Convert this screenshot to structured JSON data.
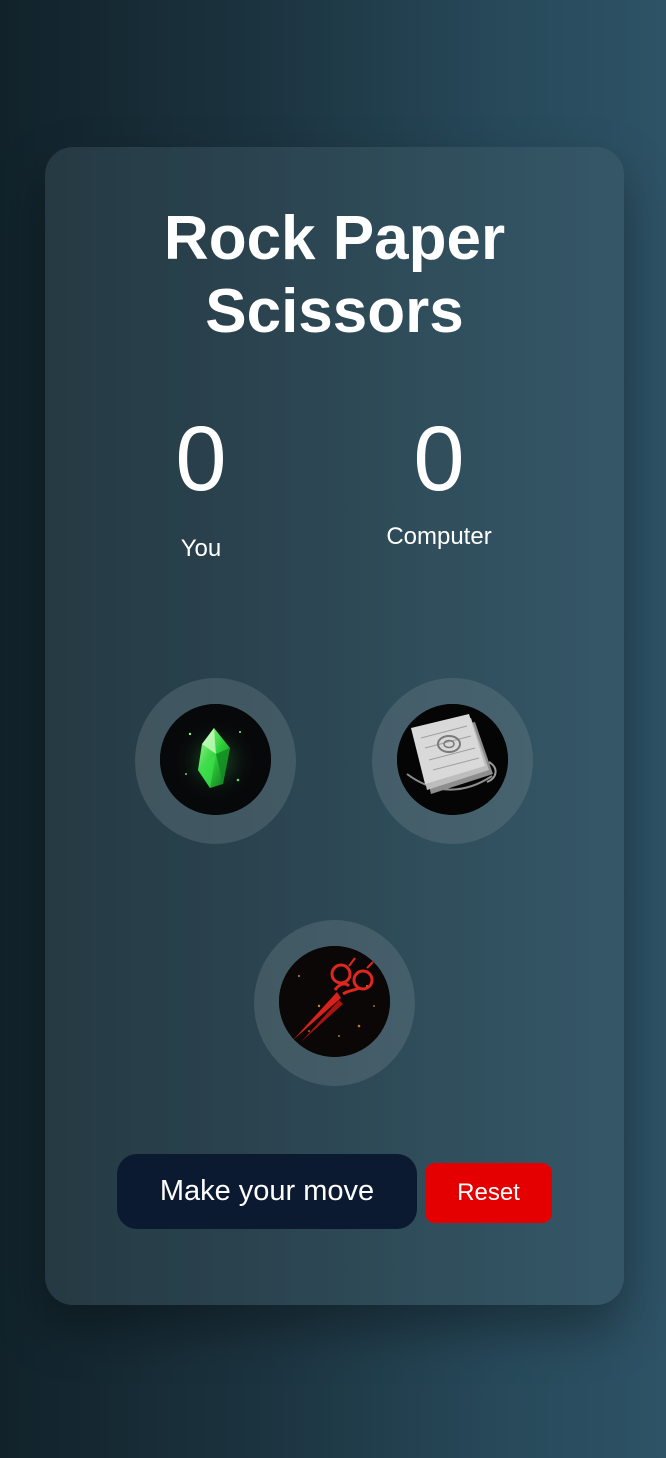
{
  "game": {
    "title": "Rock Paper Scissors"
  },
  "scores": {
    "player_score": "0",
    "player_label": "You",
    "computer_score": "0",
    "computer_label": "Computer"
  },
  "choices": [
    {
      "name": "rock",
      "icon": "green-crystal-icon"
    },
    {
      "name": "paper",
      "icon": "paper-stack-icon"
    },
    {
      "name": "scissors",
      "icon": "red-scissors-icon"
    }
  ],
  "status": {
    "message": "Make your move"
  },
  "controls": {
    "reset_label": "Reset"
  },
  "colors": {
    "status_bg": "#0b1a31",
    "reset_bg": "#e40000",
    "text": "#ffffff"
  }
}
